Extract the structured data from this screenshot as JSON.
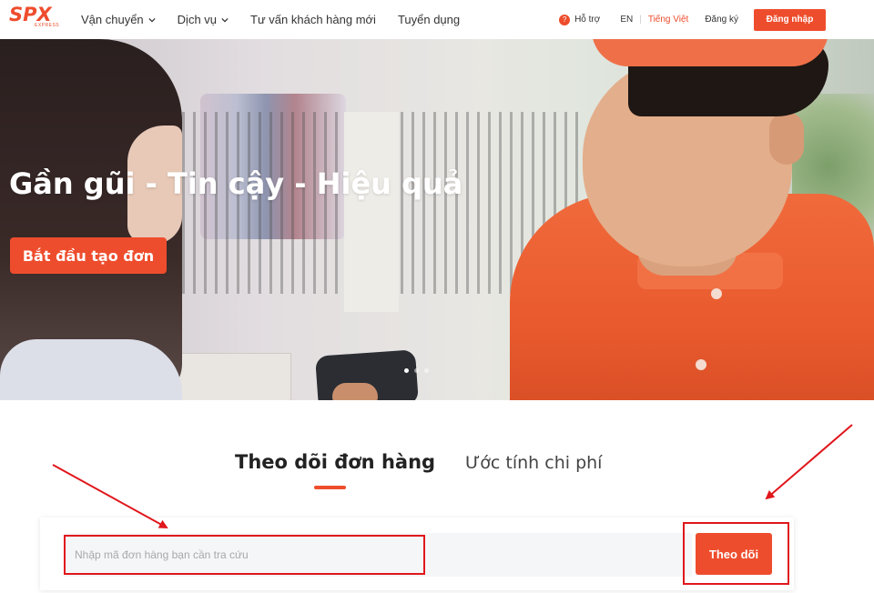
{
  "header": {
    "logo_text": "SPX",
    "logo_subtext": "EXPRESS",
    "nav": [
      {
        "label": "Vận chuyển",
        "has_dropdown": true
      },
      {
        "label": "Dịch vụ",
        "has_dropdown": true
      },
      {
        "label": "Tư vấn khách hàng mới",
        "has_dropdown": false
      },
      {
        "label": "Tuyển dụng",
        "has_dropdown": false
      }
    ],
    "support_label": "Hỗ trợ",
    "lang_en": "EN",
    "lang_separator": "|",
    "lang_vi": "Tiếng Việt",
    "signup_label": "Đăng ký",
    "login_label": "Đăng nhập",
    "brand_color": "#ee4d2d"
  },
  "hero": {
    "title": "Gần gũi - Tin cậy - Hiệu quả",
    "cta_label": "Bắt đầu tạo đơn",
    "carousel_dots": 3,
    "active_dot": 0
  },
  "tracking": {
    "tabs": [
      {
        "label": "Theo dõi đơn hàng",
        "active": true
      },
      {
        "label": "Ước tính chi phí",
        "active": false
      }
    ],
    "input_placeholder": "Nhập mã đơn hàng bạn cần tra cứu",
    "input_value": "",
    "button_label": "Theo dõi"
  },
  "annotations": {
    "color": "#e0171c",
    "highlighted": [
      "tracking-input",
      "track-button"
    ]
  }
}
